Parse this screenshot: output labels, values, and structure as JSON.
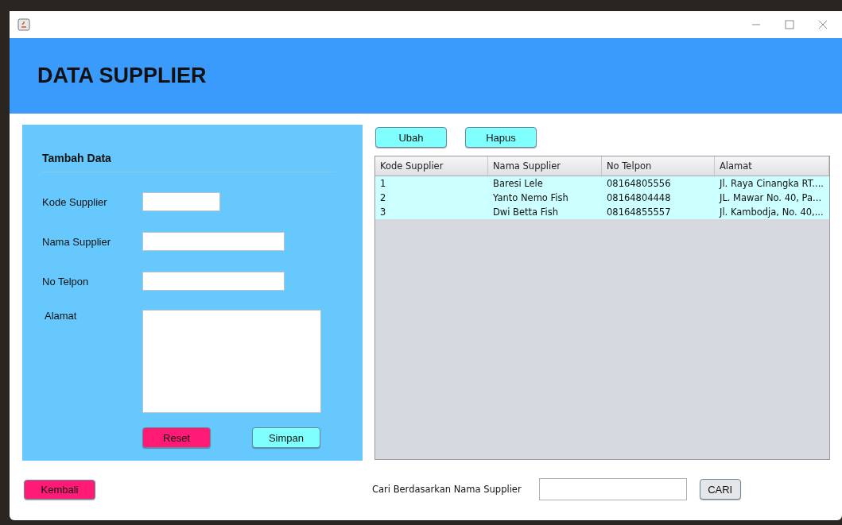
{
  "header": {
    "title": "DATA SUPPLIER"
  },
  "form": {
    "title": "Tambah Data",
    "fields": [
      {
        "label": "Kode Supplier",
        "kind": "short"
      },
      {
        "label": "Nama Supplier",
        "kind": "medium"
      },
      {
        "label": "No Telpon",
        "kind": "medium"
      },
      {
        "label": "Alamat",
        "kind": "area"
      }
    ],
    "buttons": [
      {
        "label": "Reset",
        "color": "#ff1a75"
      },
      {
        "label": "Simpan",
        "color": "#80ffff"
      }
    ]
  },
  "actions": [
    {
      "label": "Ubah",
      "color": "#80ffff"
    },
    {
      "label": "Hapus",
      "color": "#80ffff"
    }
  ],
  "table": {
    "columns": [
      "Kode Supplier",
      "Nama Supplier",
      "No Telpon",
      "Alamat"
    ],
    "rows": [
      [
        "1",
        "Baresi Lele",
        "08164805556",
        "Jl. Raya Cinangka RT...."
      ],
      [
        "2",
        "Yanto Nemo Fish",
        "08164804448",
        "JL. Mawar No. 40, Pa..."
      ],
      [
        "3",
        "Dwi Betta Fish",
        "08164855557",
        "Jl. Kambodja, No. 40,..."
      ]
    ]
  },
  "back_button": {
    "label": "Kembali",
    "color": "#ff1a75"
  },
  "search": {
    "label": "Cari Berdasarkan Nama Supplier",
    "button": "CARI"
  }
}
